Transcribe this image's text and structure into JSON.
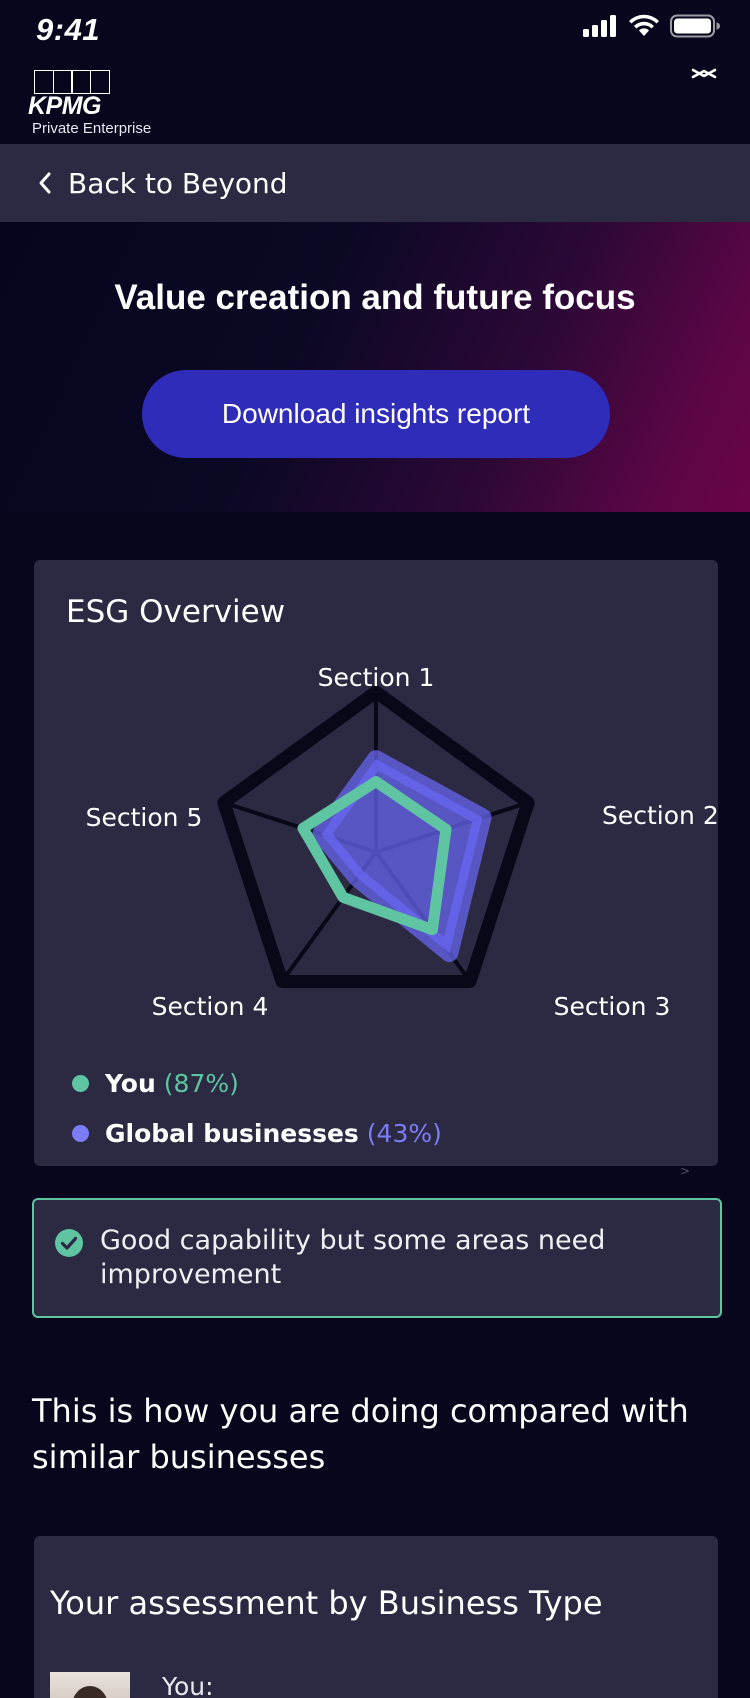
{
  "status_bar": {
    "time": "9:41"
  },
  "header": {
    "logo_text": "KPMG",
    "logo_subtitle": "Private Enterprise"
  },
  "nav": {
    "back_label": "Back to Beyond"
  },
  "hero": {
    "title": "Value creation and future focus",
    "download_label": "Download insights report"
  },
  "chart_data": {
    "type": "radar",
    "title": "ESG Overview",
    "axes": [
      "Section 1",
      "Section 2",
      "Section 3",
      "Section 4",
      "Section 5"
    ],
    "range": [
      0,
      100
    ],
    "grid": true,
    "series": [
      {
        "name": "You",
        "legend_value": "(87%)",
        "color": "#5fc4a2",
        "style": "outline",
        "values": [
          44,
          46,
          60,
          35,
          48
        ]
      },
      {
        "name": "Global businesses",
        "legend_value": "(43%)",
        "color": "#6a68f5",
        "style": "filled",
        "values": [
          58,
          70,
          78,
          20,
          36
        ]
      }
    ]
  },
  "result": {
    "message": "Good capability but some areas need improvement"
  },
  "comparison": {
    "heading": "This is how you are doing compared with similar businesses",
    "card_title": "Your assessment by Business Type",
    "you_label": "You:"
  },
  "colors": {
    "background": "#07061c",
    "card": "#2c2a42",
    "accent_green": "#5fc4a2",
    "accent_purple": "#6a68f5",
    "button": "#2f2cb9"
  }
}
